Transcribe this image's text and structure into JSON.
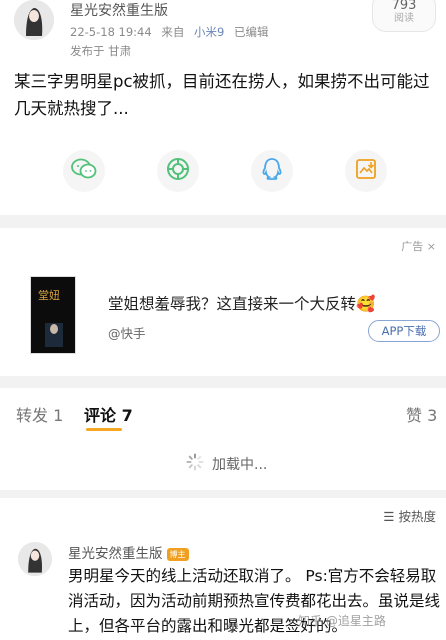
{
  "post": {
    "author": "星光安然重生版",
    "date": "22-5-18 19:44",
    "from_label": "来自",
    "device": "小米9",
    "edited": "已编辑",
    "location": "发布于 甘肃",
    "views": {
      "count": "793",
      "label": "阅读"
    },
    "text": "某三字男明星pc被抓，目前还在捞人，如果捞不出可能过几天就热搜了..."
  },
  "share": [
    {
      "icon": "wechat-icon",
      "color": "#52c17a"
    },
    {
      "icon": "moments-icon",
      "color": "#52c17a"
    },
    {
      "icon": "qq-icon",
      "color": "#4aa8e8"
    },
    {
      "icon": "save-image-icon",
      "color": "#f0a020"
    }
  ],
  "ad": {
    "tag": "广告 ×",
    "headline": "堂姐想羞辱我？这直接来一个大反转🥰",
    "source": "@快手",
    "button": "APP下载"
  },
  "tabs": {
    "repost": "转发 1",
    "comments": "评论 7",
    "likes": "赞 3"
  },
  "loading": {
    "text": "加载中..."
  },
  "comments": {
    "sort_label": "按热度",
    "items": [
      {
        "author": "星光安然重生版",
        "badge": "博主",
        "text": "男明星今天的线上活动还取消了。 Ps:官方不会轻易取消活动，因为活动前期预热宣传费都花出去。虽说是线上，但各平台的露出和曝光都是签好的。"
      }
    ]
  },
  "watermark": "知乎 @追星主路"
}
